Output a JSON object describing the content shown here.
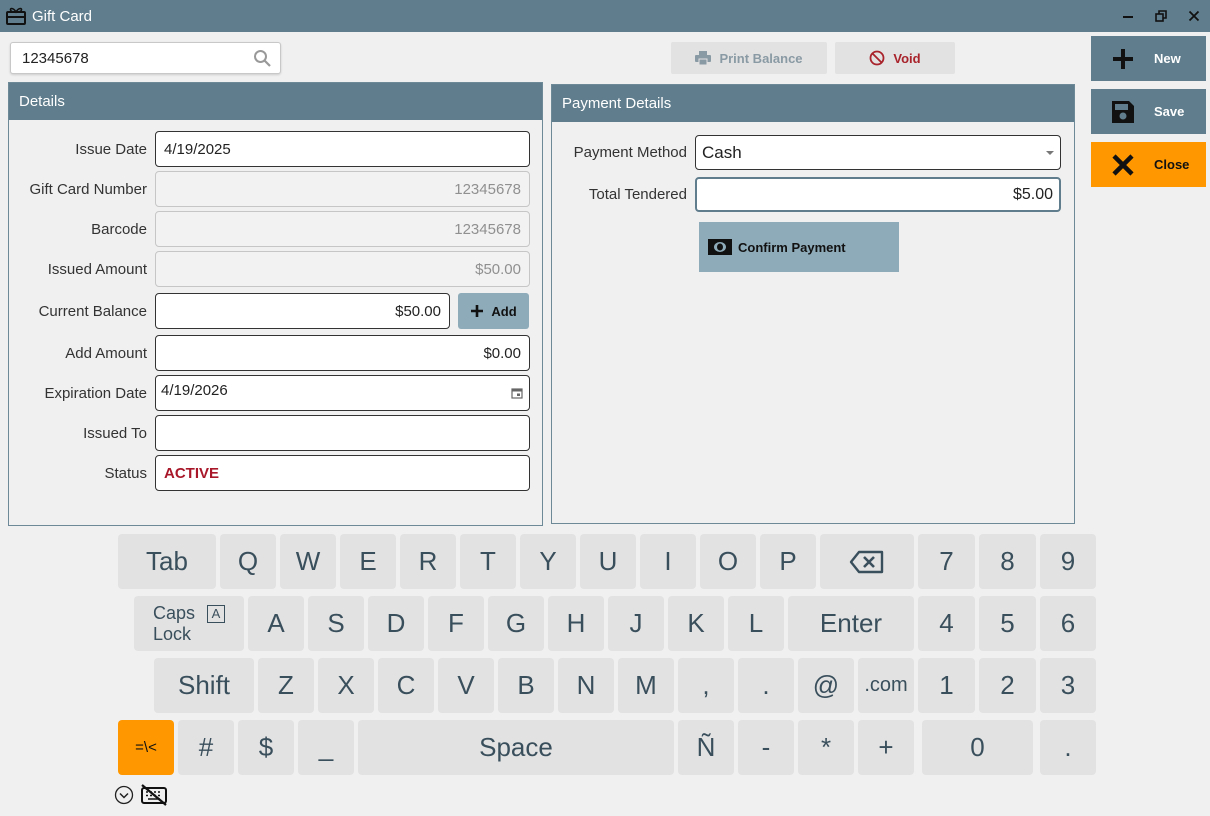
{
  "window": {
    "title": "Gift Card"
  },
  "search": {
    "value": "12345678"
  },
  "toolbar": {
    "print_balance": "Print Balance",
    "void": "Void"
  },
  "actions": {
    "new": "New",
    "save": "Save",
    "close": "Close"
  },
  "details": {
    "header": "Details",
    "issue_date_label": "Issue Date",
    "issue_date": "4/19/2025",
    "gift_card_number_label": "Gift Card Number",
    "gift_card_number": "12345678",
    "barcode_label": "Barcode",
    "barcode": "12345678",
    "issued_amount_label": "Issued Amount",
    "issued_amount": "$50.00",
    "current_balance_label": "Current Balance",
    "current_balance": "$50.00",
    "add_button": "Add",
    "add_amount_label": "Add Amount",
    "add_amount": "$0.00",
    "expiration_date_label": "Expiration Date",
    "expiration_date": "4/19/2026",
    "issued_to_label": "Issued To",
    "issued_to": "",
    "status_label": "Status",
    "status": "ACTIVE"
  },
  "payment": {
    "header": "Payment Details",
    "method_label": "Payment Method",
    "method": "Cash",
    "tendered_label": "Total Tendered",
    "tendered": "$5.00",
    "confirm_button": "Confirm Payment"
  },
  "keyboard": {
    "row1": [
      "Tab",
      "Q",
      "W",
      "E",
      "R",
      "T",
      "Y",
      "U",
      "I",
      "O",
      "P"
    ],
    "row1_num": [
      "7",
      "8",
      "9"
    ],
    "caps_line1": "Caps",
    "caps_line2": "Lock",
    "caps_indicator": "A",
    "row2": [
      "A",
      "S",
      "D",
      "F",
      "G",
      "H",
      "J",
      "K",
      "L",
      "Enter"
    ],
    "row2_num": [
      "4",
      "5",
      "6"
    ],
    "row3": [
      "Shift",
      "Z",
      "X",
      "C",
      "V",
      "B",
      "N",
      "M",
      ",",
      ".",
      "@",
      ".com"
    ],
    "row3_num": [
      "1",
      "2",
      "3"
    ],
    "symbols_toggle": "=\\<",
    "row4": [
      "#",
      "$",
      "_",
      "Space",
      "Ñ",
      "-",
      "*",
      "+",
      "0",
      "."
    ]
  }
}
